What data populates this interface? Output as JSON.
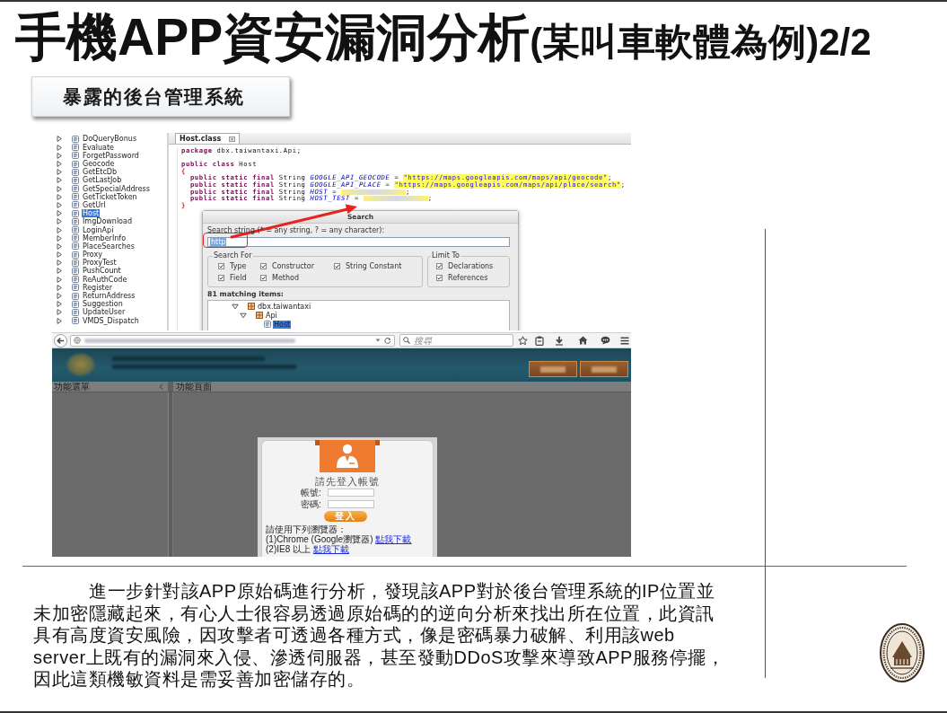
{
  "title": {
    "main": "手機APP資安漏洞分析",
    "suffix": "(某叫車軟體為例)2/2"
  },
  "section_label": "暴露的後台管理系統",
  "ide_screenshot": {
    "class_tree": [
      {
        "label": "DoQueryBonus",
        "expanded": false,
        "selected": false
      },
      {
        "label": "Evaluate",
        "expanded": false,
        "selected": false
      },
      {
        "label": "ForgetPassword",
        "expanded": false,
        "selected": false
      },
      {
        "label": "Geocode",
        "expanded": false,
        "selected": false
      },
      {
        "label": "GetEtcDb",
        "expanded": false,
        "selected": false
      },
      {
        "label": "GetLastJob",
        "expanded": false,
        "selected": false
      },
      {
        "label": "GetSpecialAddress",
        "expanded": false,
        "selected": false
      },
      {
        "label": "GetTicketToken",
        "expanded": false,
        "selected": false
      },
      {
        "label": "GetUrl",
        "expanded": false,
        "selected": false
      },
      {
        "label": "Host",
        "expanded": false,
        "selected": true
      },
      {
        "label": "ImgDownload",
        "expanded": false,
        "selected": false
      },
      {
        "label": "LoginApi",
        "expanded": false,
        "selected": false
      },
      {
        "label": "MemberInfo",
        "expanded": false,
        "selected": false
      },
      {
        "label": "PlaceSearches",
        "expanded": false,
        "selected": false
      },
      {
        "label": "Proxy",
        "expanded": false,
        "selected": false
      },
      {
        "label": "ProxyTest",
        "expanded": false,
        "selected": false
      },
      {
        "label": "PushCount",
        "expanded": false,
        "selected": false
      },
      {
        "label": "ReAuthCode",
        "expanded": false,
        "selected": false
      },
      {
        "label": "Register",
        "expanded": false,
        "selected": false
      },
      {
        "label": "ReturnAddress",
        "expanded": false,
        "selected": false
      },
      {
        "label": "Suggestion",
        "expanded": false,
        "selected": false
      },
      {
        "label": "UpdateUser",
        "expanded": false,
        "selected": false
      },
      {
        "label": "VMDS_Dispatch",
        "expanded": false,
        "selected": false
      }
    ],
    "editor_tab": "Host.class",
    "code_blocks": [
      [
        {
          "tokens": [
            {
              "kind": "keyword",
              "text": "package"
            },
            {
              "kind": "plain",
              "text": " dbx.taiwantaxi.Api;"
            }
          ]
        }
      ],
      [
        {
          "tokens": [
            {
              "kind": "keyword",
              "text": "public class"
            },
            {
              "kind": "plain",
              "text": " Host"
            }
          ]
        },
        {
          "tokens": [
            {
              "kind": "brace",
              "text": "{"
            }
          ],
          "children": [
            {
              "tokens": [
                {
                  "kind": "keyword",
                  "text": "public static final"
                },
                {
                  "kind": "plain",
                  "text": " String "
                },
                {
                  "kind": "field",
                  "text": "GOOGLE_API_GEOCODE"
                },
                {
                  "kind": "plain",
                  "text": " = "
                },
                {
                  "kind": "match",
                  "text": "\"https://maps.googleapis.com/maps/api/geocode\""
                },
                {
                  "kind": "plain",
                  "text": ";"
                }
              ]
            },
            {
              "tokens": [
                {
                  "kind": "keyword",
                  "text": "public static final"
                },
                {
                  "kind": "plain",
                  "text": " String "
                },
                {
                  "kind": "field",
                  "text": "GOOGLE_API_PLACE"
                },
                {
                  "kind": "plain",
                  "text": " = "
                },
                {
                  "kind": "match",
                  "text": "\"https://maps.googleapis.com/maps/api/place/search\""
                },
                {
                  "kind": "plain",
                  "text": ";"
                }
              ]
            },
            {
              "tokens": [
                {
                  "kind": "keyword",
                  "text": "public static final"
                },
                {
                  "kind": "plain",
                  "text": " String "
                },
                {
                  "kind": "field",
                  "text": "HOST"
                },
                {
                  "kind": "plain",
                  "text": " = "
                },
                {
                  "kind": "redacted"
                },
                {
                  "kind": "plain",
                  "text": ";"
                }
              ]
            },
            {
              "tokens": [
                {
                  "kind": "keyword",
                  "text": "public static final"
                },
                {
                  "kind": "plain",
                  "text": " String "
                },
                {
                  "kind": "field",
                  "text": "HOST_TEST"
                },
                {
                  "kind": "plain",
                  "text": " = "
                },
                {
                  "kind": "redacted"
                },
                {
                  "kind": "plain",
                  "text": ";"
                }
              ]
            }
          ]
        },
        {
          "tokens": [
            {
              "kind": "brace",
              "text": "}"
            }
          ]
        }
      ]
    ],
    "search_dialog": {
      "title": "Search",
      "prompt": "Search string (* = any string, ? = any character):",
      "value": "http",
      "value_selected": true,
      "search_for": {
        "legend": "Search For",
        "options": [
          {
            "label": "Type",
            "checked": true
          },
          {
            "label": "Constructor",
            "checked": true
          },
          {
            "label": "String Constant",
            "checked": true
          },
          {
            "label": "Field",
            "checked": true
          },
          {
            "label": "Method",
            "checked": true
          }
        ]
      },
      "limit_to": {
        "legend": "Limit To",
        "options": [
          {
            "label": "Declarations",
            "checked": true
          },
          {
            "label": "References",
            "checked": true
          }
        ]
      },
      "match_count": "81 matching items:",
      "results": [
        {
          "label": "dbx.taiwantaxi",
          "kind": "package",
          "expanded": true,
          "selected": false,
          "children": [
            {
              "label": "Api",
              "kind": "package",
              "expanded": true,
              "selected": false,
              "children": [
                {
                  "label": "Host",
                  "kind": "class",
                  "selected": true
                }
              ]
            }
          ]
        }
      ]
    }
  },
  "browser_screenshot": {
    "search_placeholder": "搜尋",
    "menu_panel_title": "功能選單",
    "content_panel_title": "功能頁面",
    "login": {
      "heading": "請先登入帳號",
      "fields": [
        {
          "label": "帳號:"
        },
        {
          "label": "密碼:"
        }
      ],
      "button": "登入",
      "note": "請使用下列瀏覽器：",
      "downloads": [
        {
          "text": "(1)Chrome (Google瀏覽器)",
          "link": "點我下載"
        },
        {
          "text": "(2)IE8 以上",
          "link": "點我下載"
        }
      ]
    }
  },
  "paragraph": "進一步針對該APP原始碼進行分析，發現該APP對於後台管理系統的IP位置並未加密隱藏起來，有心人士很容易透過原始碼的的逆向分析來找出所在位置，此資訊具有高度資安風險，因攻擊者可透過各種方式，像是密碼暴力破解、利用該web server上既有的漏洞來入侵、滲透伺服器，甚至發動DDoS攻擊來導致APP服務停擺，因此這類機敏資料是需妥善加密儲存的。"
}
